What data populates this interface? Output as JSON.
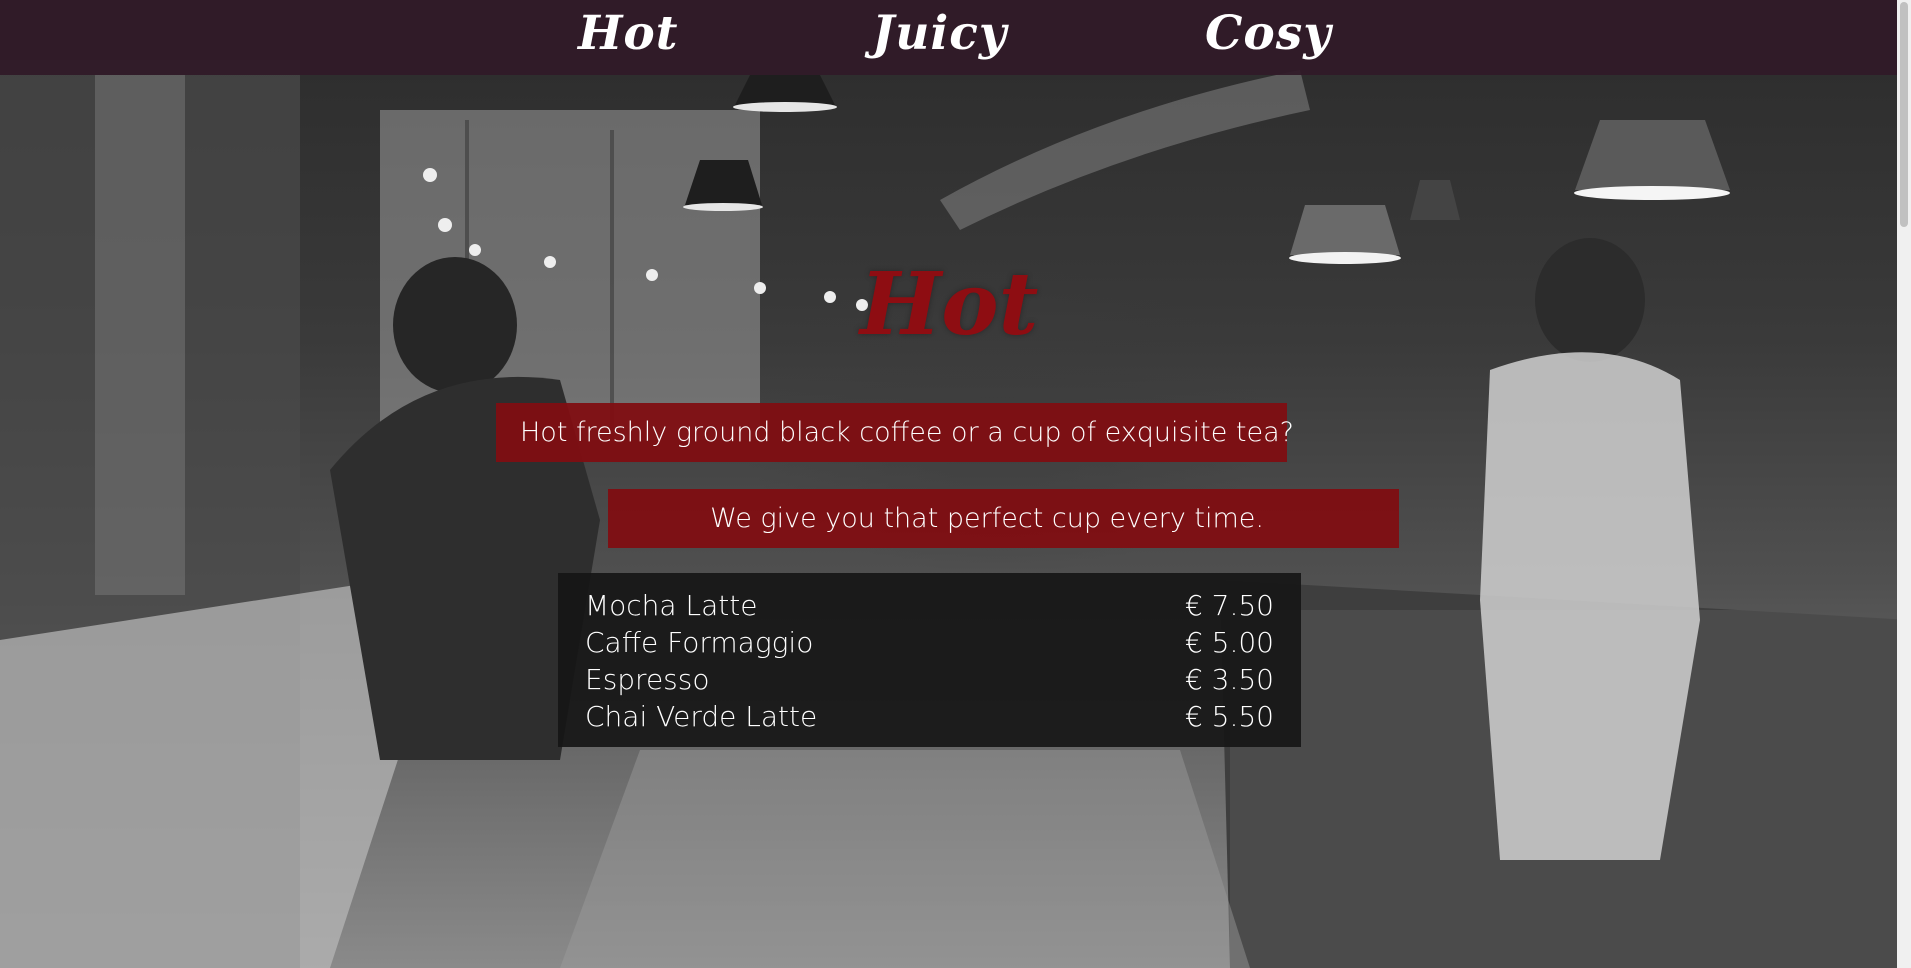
{
  "nav": {
    "items": [
      {
        "label": "Hot"
      },
      {
        "label": "Juicy"
      },
      {
        "label": "Cosy"
      }
    ]
  },
  "section": {
    "title": "Hot",
    "banner_1": "Hot freshly ground black coffee or a cup of exquisite tea?",
    "banner_2": "We give you that perfect cup every time."
  },
  "menu": {
    "items": [
      {
        "name": "Mocha Latte",
        "price": "€ 7.50"
      },
      {
        "name": "Caffe Formaggio",
        "price": "€ 5.00"
      },
      {
        "name": "Espresso",
        "price": "€ 3.50"
      },
      {
        "name": "Chai Verde Latte",
        "price": "€ 5.50"
      }
    ]
  },
  "colors": {
    "navbar": "#301a28",
    "accent_red": "#800e12",
    "title_red": "#8e0d12",
    "menu_bg": "#161616"
  }
}
